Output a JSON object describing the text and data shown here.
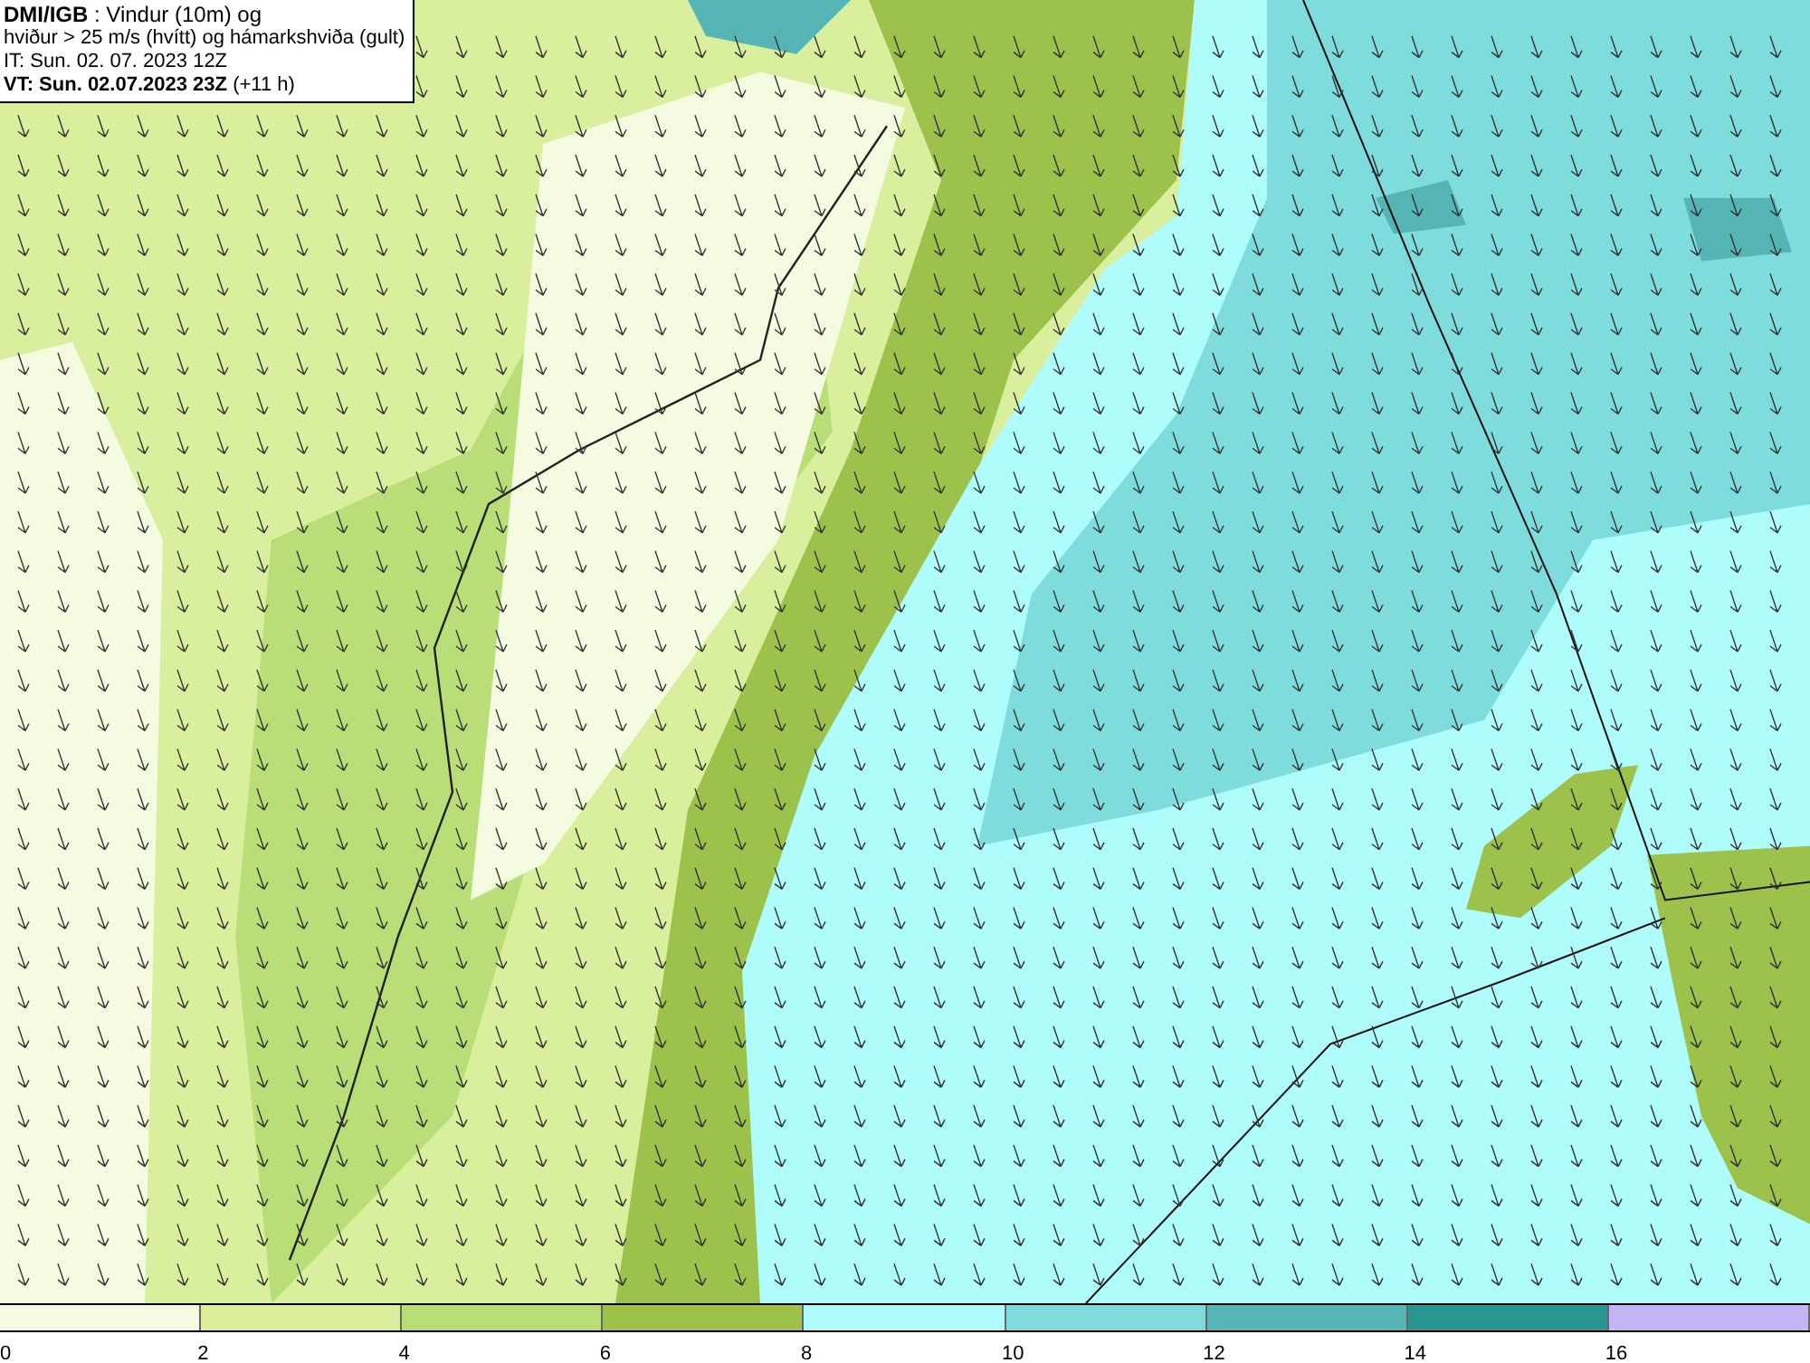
{
  "title_box": {
    "lines": [
      "**DMI/IGB** : Vindur (10m) og",
      "hviður > 25 m/s (hvítt) og hámarkshviða (gult)",
      "IT: Sun. 02. 07. 2023 12Z",
      "**VT: Sun. 02.07.2023 23Z** (+11 h)"
    ]
  },
  "legend": [
    {
      "label": "0",
      "color": "#f5fbe0"
    },
    {
      "label": "2",
      "color": "#d9ef9e"
    },
    {
      "label": "4",
      "color": "#b9de78"
    },
    {
      "label": "6",
      "color": "#9cc24c"
    },
    {
      "label": "8",
      "color": "#aefcfc"
    },
    {
      "label": "10",
      "color": "#7fdcdc"
    },
    {
      "label": "12",
      "color": "#55b5b5"
    },
    {
      "label": "14",
      "color": "#2a9592"
    },
    {
      "label": "16",
      "color": "#c4b4f8"
    }
  ]
}
